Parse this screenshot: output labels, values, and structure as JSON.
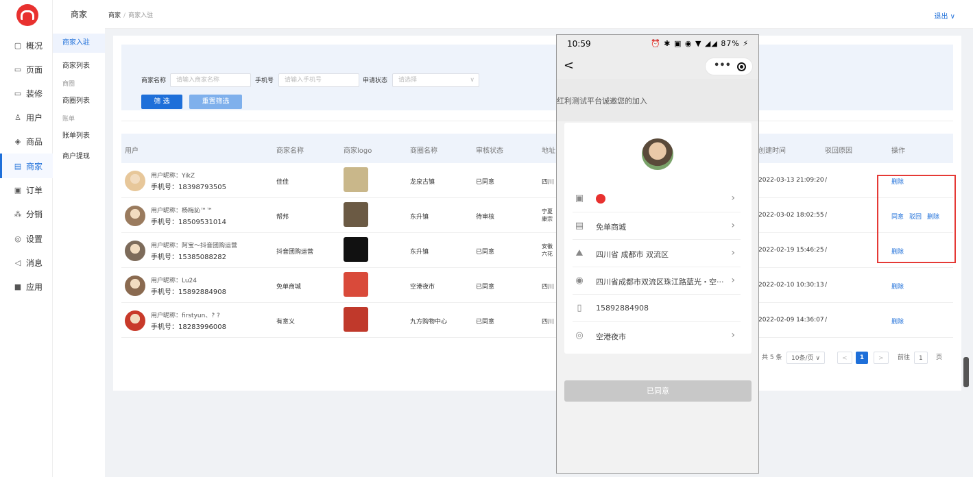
{
  "sidebar": {
    "items": [
      {
        "label": "概况",
        "icon": "overview-icon",
        "glyph": "▢"
      },
      {
        "label": "页面",
        "icon": "page-icon",
        "glyph": "▭"
      },
      {
        "label": "装修",
        "icon": "decorate-icon",
        "glyph": "▭"
      },
      {
        "label": "用户",
        "icon": "user-icon",
        "glyph": "♙"
      },
      {
        "label": "商品",
        "icon": "goods-icon",
        "glyph": "◈"
      },
      {
        "label": "商家",
        "icon": "merchant-icon",
        "glyph": "▤"
      },
      {
        "label": "订单",
        "icon": "order-icon",
        "glyph": "▣"
      },
      {
        "label": "分销",
        "icon": "distribution-icon",
        "glyph": "⁂"
      },
      {
        "label": "设置",
        "icon": "settings-icon",
        "glyph": "◎"
      },
      {
        "label": "消息",
        "icon": "message-icon",
        "glyph": "◁"
      },
      {
        "label": "应用",
        "icon": "apps-icon",
        "glyph": "■"
      }
    ],
    "active_index": 5
  },
  "subsidebar": {
    "title": "商家",
    "item_ruzhu": "商家入驻",
    "item_list": "商家列表",
    "group_shangquan": "商圈",
    "item_shangquan_list": "商圈列表",
    "group_zhangdan": "账单",
    "item_zhangdan_list": "账单列表",
    "item_withdraw": "商户提现"
  },
  "topbar": {
    "crumb_root": "商家",
    "crumb_sep": "/",
    "crumb_current": "商家入驻",
    "logout": "退出 ∨"
  },
  "filter": {
    "name_label": "商家名称",
    "name_placeholder": "请输入商家名称",
    "phone_label": "手机号",
    "phone_placeholder": "请输入手机号",
    "status_label": "申请状态",
    "status_placeholder": "请选择",
    "filter_button": "筛 选",
    "reset_button": "重置筛选"
  },
  "table": {
    "headers": {
      "user": "用户",
      "name": "商家名称",
      "logo": "商家logo",
      "circle": "商圈名称",
      "status": "审核状态",
      "address": "地址",
      "created": "创建时间",
      "reason": "驳回原因",
      "ops": "操作"
    },
    "rows": [
      {
        "nick": "用户昵称：YikZ",
        "phone": "手机号：18398793505",
        "name": "佳佳",
        "circle": "龙泉古镇",
        "status": "已同意",
        "address": "四川",
        "created": "2022-03-13 21:09:20",
        "reason": "/",
        "ops": [
          "删除"
        ],
        "avatar_color": "#e7c79a",
        "logo_color": "#c9b78a"
      },
      {
        "nick": "用户昵称：杨梅訫™™",
        "phone": "手机号：18509531014",
        "name": "帮邦",
        "circle": "东升镇",
        "status": "待审核",
        "address": "宁夏\n康宗",
        "created": "2022-03-02 18:02:55",
        "reason": "/",
        "ops": [
          "同意",
          "驳回",
          "删除"
        ],
        "avatar_color": "#9a7b5e",
        "logo_color": "#6b5a44"
      },
      {
        "nick": "用户昵称：阿宝～抖音团购运营",
        "phone": "手机号：15385088282",
        "name": "抖音团购运营",
        "circle": "东升镇",
        "status": "已同意",
        "address": "安徽\n六花",
        "created": "2022-02-19 15:46:25",
        "reason": "/",
        "ops": [
          "删除"
        ],
        "avatar_color": "#7d6b5a",
        "logo_color": "#111111"
      },
      {
        "nick": "用户昵称：Lu24",
        "phone": "手机号：15892884908",
        "name": "免单商城",
        "circle": "空港夜市",
        "status": "已同意",
        "address": "四川",
        "created": "2022-02-10 10:30:13",
        "reason": "/",
        "ops": [
          "删除"
        ],
        "avatar_color": "#8a6a50",
        "logo_color": "#d94a3a"
      },
      {
        "nick": "用户昵称：firstyun、? ?",
        "phone": "手机号：18283996008",
        "name": "有意义",
        "circle": "九方购物中心",
        "status": "已同意",
        "address": "四川",
        "created": "2022-02-09 14:36:07",
        "reason": "/",
        "ops": [
          "删除"
        ],
        "avatar_color": "#c83a2a",
        "logo_color": "#c0392b"
      }
    ]
  },
  "pager": {
    "total": "共 5 条",
    "page_size": "10条/页 ∨",
    "prev": "<",
    "current": "1",
    "next": ">",
    "goto_label": "前往",
    "goto_value": "1",
    "page_suffix": "页"
  },
  "phone": {
    "time": "10:59",
    "status_icons": "⏰ ✱ ▣ ◉ ▼ ◢◢ 87% ⚡",
    "back": "<",
    "capsule_dots": "•••",
    "invite": "红利测试平台诚邀您的加入",
    "rows": [
      {
        "icon": "image-icon",
        "glyph": "▣",
        "text": "",
        "arrow": true
      },
      {
        "icon": "shop-icon",
        "glyph": "▤",
        "text": "免单商城",
        "arrow": true
      },
      {
        "icon": "region-icon",
        "glyph": "⛰",
        "text": "四川省 成都市 双流区",
        "arrow": true
      },
      {
        "icon": "location-icon",
        "glyph": "◉",
        "text": "四川省成都市双流区珠江路蓝光・空···",
        "arrow": true
      },
      {
        "icon": "phone-icon",
        "glyph": "▯",
        "text": "15892884908",
        "arrow": false
      },
      {
        "icon": "circle-icon",
        "glyph": "◎",
        "text": "空港夜市",
        "arrow": true
      }
    ],
    "agree_button": "已同意"
  },
  "colors": {
    "accent": "#1e6fd9",
    "brand_red": "#e8312f",
    "highlight_box": "#e53935"
  }
}
